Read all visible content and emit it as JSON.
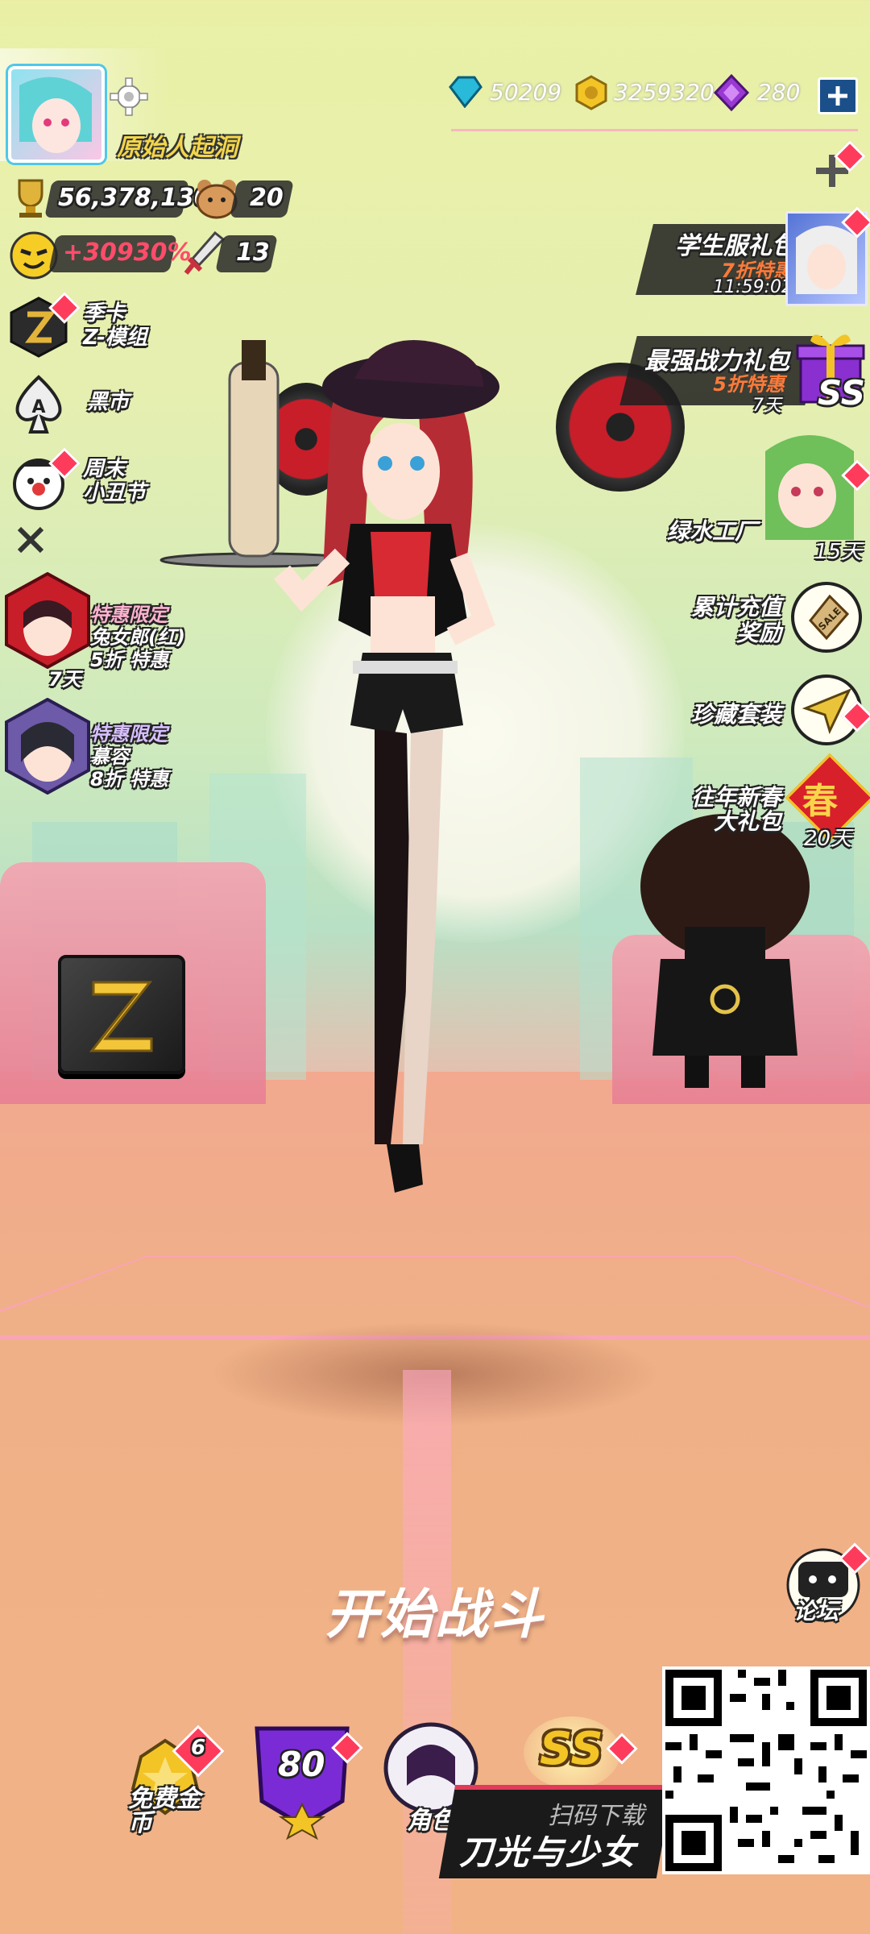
{
  "player": {
    "name": "原始人起洞"
  },
  "currencies": [
    {
      "icon": "diamond-gem-icon",
      "value": "50209",
      "color": "#2ab6d6"
    },
    {
      "icon": "gold-coin-icon",
      "value": "3259320",
      "color": "#f0c020"
    },
    {
      "icon": "purple-crystal-icon",
      "value": "280",
      "color": "#9b3ad6"
    }
  ],
  "stats": {
    "trophies": "56,378,130",
    "bear_count": "20",
    "bonus_percent": "+30930%",
    "sword_count": "13"
  },
  "left_menu": [
    {
      "title": "季卡",
      "subtitle": "Z-模组"
    },
    {
      "title": "黑市",
      "subtitle": ""
    },
    {
      "title": "周末",
      "subtitle": "小丑节"
    }
  ],
  "left_promos": [
    {
      "line1": "特惠限定",
      "line2": "兔女郎(红)",
      "line3": "5折 特惠",
      "timer": "7天"
    },
    {
      "line1": "特惠限定",
      "line2": "慕容",
      "line3": "8折 特惠",
      "timer": ""
    }
  ],
  "right_promos": [
    {
      "title": "学生服礼包",
      "sub": "7折特惠",
      "timer": "11:59:02"
    },
    {
      "title": "最强战力礼包",
      "sub": "5折特惠",
      "timer": "7天",
      "badge": "SS"
    },
    {
      "title": "绿水工厂",
      "sub": "",
      "timer": "15天"
    },
    {
      "title": "累计充值",
      "sub": "奖励",
      "timer": ""
    },
    {
      "title": "珍藏套装",
      "sub": "",
      "timer": ""
    },
    {
      "title": "往年新春",
      "sub": "大礼包",
      "timer": "20天",
      "badge": "春"
    }
  ],
  "start_battle": "开始战斗",
  "forum": "论坛",
  "bottom_bar": [
    {
      "label": "免费金币",
      "badge": "6"
    },
    {
      "label": "",
      "badge": "80"
    },
    {
      "label": "角色",
      "badge": ""
    },
    {
      "label": "",
      "badge": "SS"
    }
  ],
  "download": {
    "line1": "扫码下载",
    "line2": "刀光与少女"
  },
  "icons": {
    "settings": "gear-icon",
    "add": "plus-icon",
    "close": "close-icon"
  }
}
